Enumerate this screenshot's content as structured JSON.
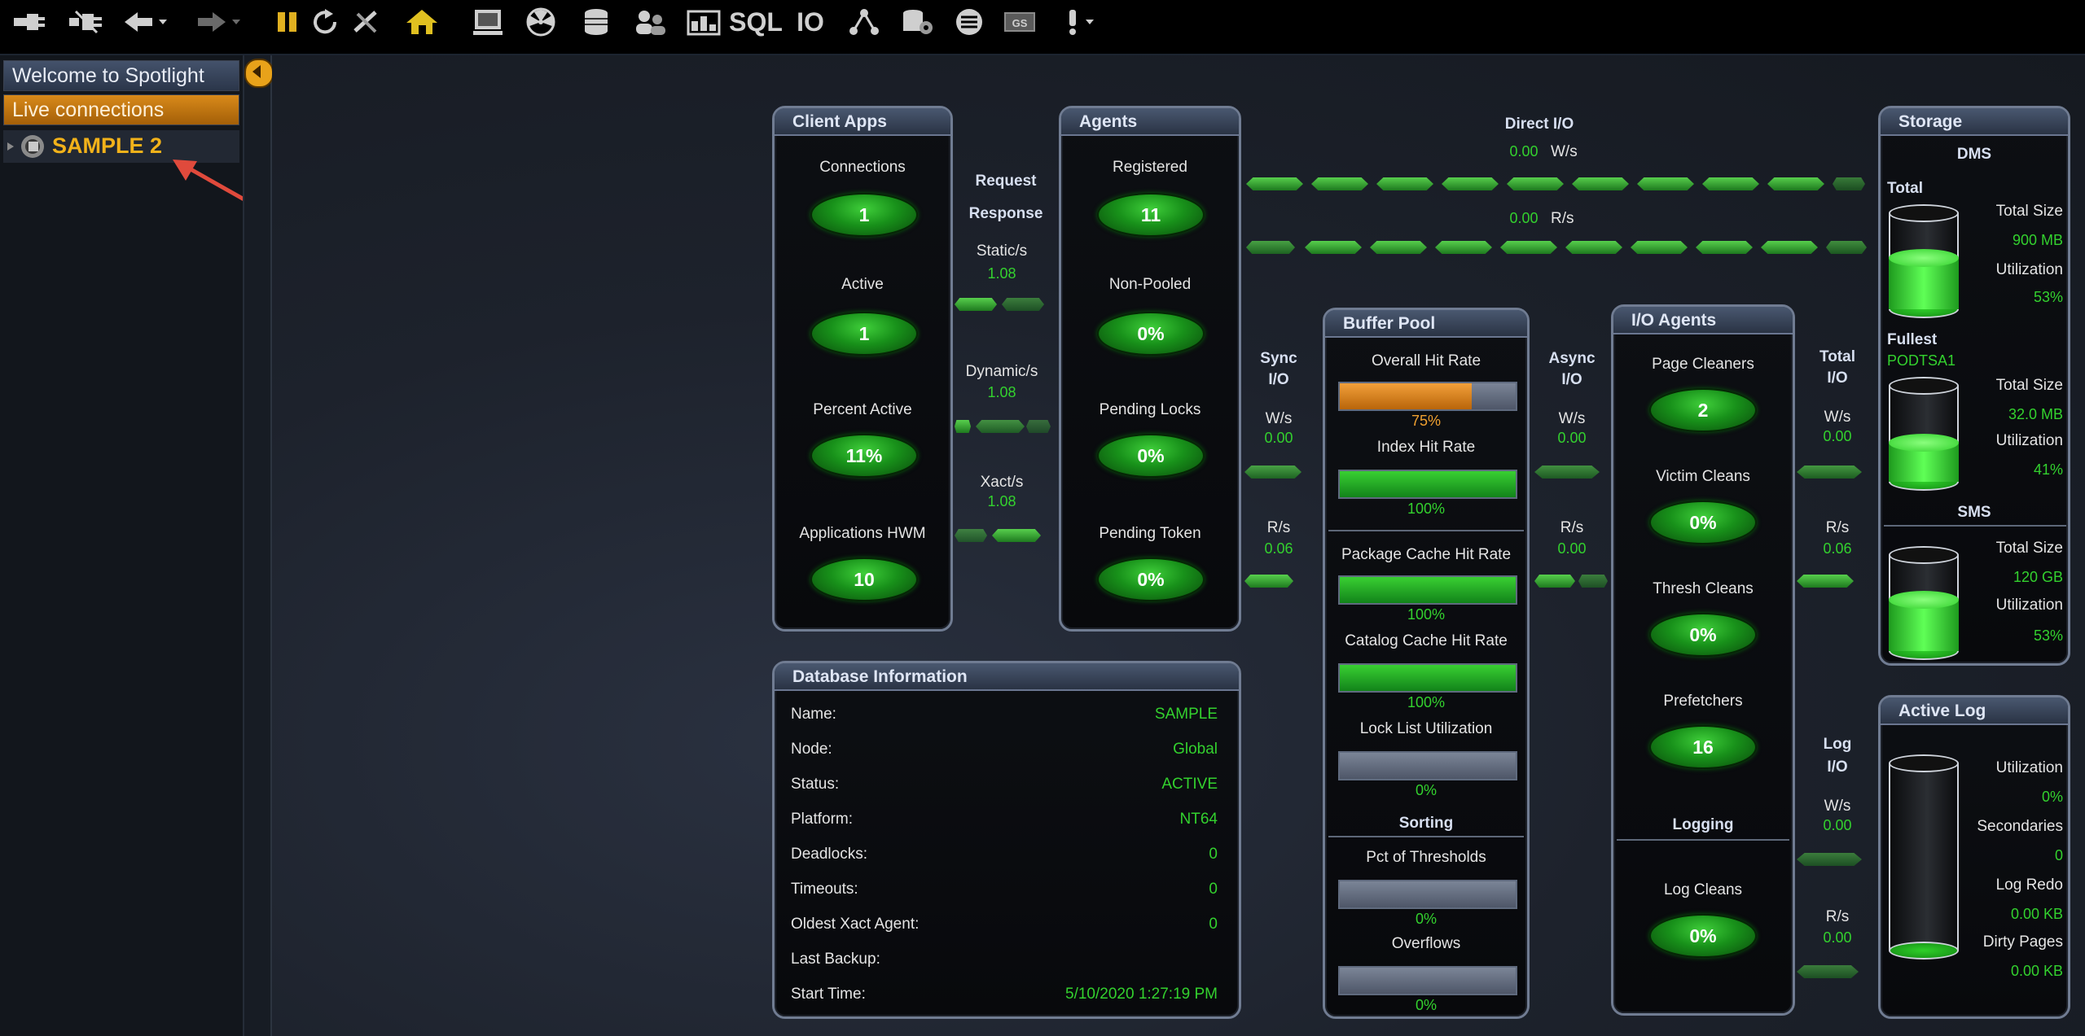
{
  "toolbar": {
    "sql_label": "SQL",
    "io_label": "IO",
    "gs_label": "GS"
  },
  "sidebar": {
    "welcome": "Welcome to Spotlight",
    "live_connections": "Live connections",
    "connection": "SAMPLE 2"
  },
  "client_apps": {
    "title": "Client Apps",
    "connections_label": "Connections",
    "connections": "1",
    "active_label": "Active",
    "active": "1",
    "percent_active_label": "Percent Active",
    "percent_active": "11%",
    "hwm_label": "Applications HWM",
    "hwm": "10"
  },
  "request_response": {
    "request": "Request",
    "response": "Response",
    "static_label": "Static/s",
    "static": "1.08",
    "dynamic_label": "Dynamic/s",
    "dynamic": "1.08",
    "xact_label": "Xact/s",
    "xact": "1.08"
  },
  "agents": {
    "title": "Agents",
    "registered_label": "Registered",
    "registered": "11",
    "nonpooled_label": "Non-Pooled",
    "nonpooled": "0%",
    "locks_label": "Pending Locks",
    "locks": "0%",
    "token_label": "Pending Token",
    "token": "0%"
  },
  "direct_io": {
    "title": "Direct I/O",
    "ws_value": "0.00",
    "ws_unit": "W/s",
    "rs_value": "0.00",
    "rs_unit": "R/s"
  },
  "sync_io": {
    "title_1": "Sync",
    "title_2": "I/O",
    "ws_label": "W/s",
    "ws": "0.00",
    "rs_label": "R/s",
    "rs": "0.06"
  },
  "buffer_pool": {
    "title": "Buffer Pool",
    "overall_label": "Overall Hit Rate",
    "overall": "75%",
    "overall_pct": 75,
    "index_label": "Index Hit Rate",
    "index": "100%",
    "index_pct": 100,
    "package_label": "Package Cache Hit Rate",
    "package": "100%",
    "package_pct": 100,
    "catalog_label": "Catalog Cache Hit Rate",
    "catalog": "100%",
    "catalog_pct": 100,
    "locklist_label": "Lock List Utilization",
    "locklist": "0%",
    "locklist_pct": 0,
    "sorting_title": "Sorting",
    "thresholds_label": "Pct of Thresholds",
    "thresholds": "0%",
    "thresholds_pct": 0,
    "overflows_label": "Overflows",
    "overflows": "0%",
    "overflows_pct": 0
  },
  "async_io": {
    "title_1": "Async",
    "title_2": "I/O",
    "ws_label": "W/s",
    "ws": "0.00",
    "rs_label": "R/s",
    "rs": "0.00"
  },
  "io_agents": {
    "title": "I/O Agents",
    "page_label": "Page Cleaners",
    "page": "2",
    "victim_label": "Victim Cleans",
    "victim": "0%",
    "thresh_label": "Thresh Cleans",
    "thresh": "0%",
    "prefetch_label": "Prefetchers",
    "prefetch": "16",
    "logging_title": "Logging",
    "logcleans_label": "Log Cleans",
    "logcleans": "0%"
  },
  "total_io": {
    "title_1": "Total",
    "title_2": "I/O",
    "ws_label": "W/s",
    "ws": "0.00",
    "rs_label": "R/s",
    "rs": "0.06"
  },
  "log_io": {
    "title_1": "Log",
    "title_2": "I/O",
    "ws_label": "W/s",
    "ws": "0.00",
    "rs_label": "R/s",
    "rs": "0.00"
  },
  "storage": {
    "title": "Storage",
    "dms_title": "DMS",
    "total_title": "Total",
    "total_size_label": "Total Size",
    "total_size": "900 MB",
    "total_util_label": "Utilization",
    "total_util": "53%",
    "total_util_pct": 53,
    "fullest_title": "Fullest",
    "fullest_name": "PODTSA1",
    "fullest_size_label": "Total Size",
    "fullest_size": "32.0 MB",
    "fullest_util_label": "Utilization",
    "fullest_util": "41%",
    "fullest_util_pct": 41,
    "sms_title": "SMS",
    "sms_size_label": "Total Size",
    "sms_size": "120 GB",
    "sms_util_label": "Utilization",
    "sms_util": "53%",
    "sms_util_pct": 53
  },
  "active_log": {
    "title": "Active Log",
    "util_label": "Utilization",
    "util": "0%",
    "util_pct": 0,
    "secondaries_label": "Secondaries",
    "secondaries": "0",
    "redo_label": "Log Redo",
    "redo": "0.00 KB",
    "dirty_label": "Dirty Pages",
    "dirty": "0.00 KB"
  },
  "db_info": {
    "title": "Database Information",
    "rows": [
      {
        "k": "Name:",
        "v": "SAMPLE"
      },
      {
        "k": "Node:",
        "v": "Global"
      },
      {
        "k": "Status:",
        "v": "ACTIVE"
      },
      {
        "k": "Platform:",
        "v": "NT64"
      },
      {
        "k": "Deadlocks:",
        "v": "0"
      },
      {
        "k": "Timeouts:",
        "v": "0"
      },
      {
        "k": "Oldest Xact Agent:",
        "v": "0"
      },
      {
        "k": "Last Backup:",
        "v": ""
      },
      {
        "k": "Start Time:",
        "v": "5/10/2020 1:27:19 PM"
      }
    ]
  },
  "colors": {
    "accent": "#e8a21a",
    "green": "#33d12e",
    "panel_border": "#707c92"
  }
}
